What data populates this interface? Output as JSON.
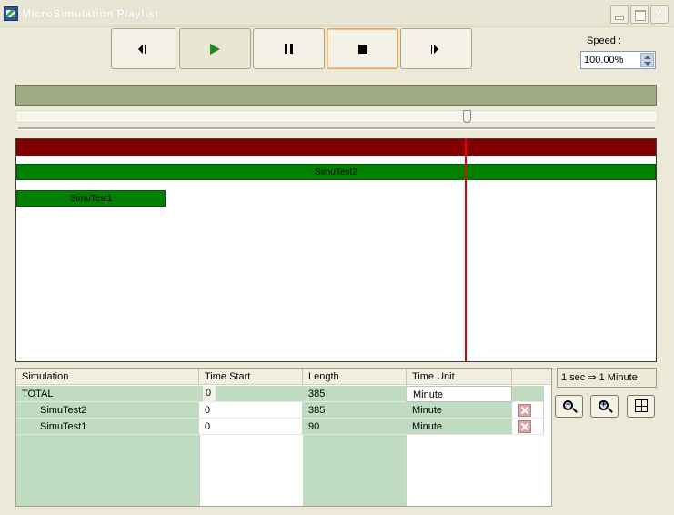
{
  "window": {
    "title": "MicroSimulation Playlist"
  },
  "speed": {
    "label": "Speed :",
    "value": "100.00%"
  },
  "playback": {
    "position_fraction": 0.703
  },
  "timeline": {
    "total_length": 385,
    "bars": [
      {
        "name": "SimuTest2",
        "start": 0,
        "length": 385
      },
      {
        "name": "SimuTest1",
        "start": 0,
        "length": 90
      }
    ]
  },
  "grid": {
    "headers": [
      "Simulation",
      "Time Start",
      "Length",
      "Time Unit"
    ],
    "rows": [
      {
        "simulation": "TOTAL",
        "time_start": "0",
        "length": "385",
        "time_unit": "Minute"
      },
      {
        "simulation": "SimuTest2",
        "time_start": "0",
        "length": "385",
        "time_unit": "Minute"
      },
      {
        "simulation": "SimuTest1",
        "time_start": "0",
        "length": "90",
        "time_unit": "Minute"
      }
    ]
  },
  "scale": {
    "text": "1 sec ⇒ 1 Minute"
  },
  "icons": {
    "prev": "step-back-icon",
    "play": "play-icon",
    "pause": "pause-icon",
    "stop": "stop-icon",
    "next": "step-forward-icon",
    "zoom_out": "zoom-out-icon",
    "zoom_in": "zoom-in-icon",
    "fit": "fit-to-window-icon"
  },
  "colors": {
    "total_bar": "#800000",
    "sim_bar": "#008000",
    "playhead": "#ee0000",
    "progress": "#9eaa7f",
    "grid_fill": "#c0dcc0"
  }
}
